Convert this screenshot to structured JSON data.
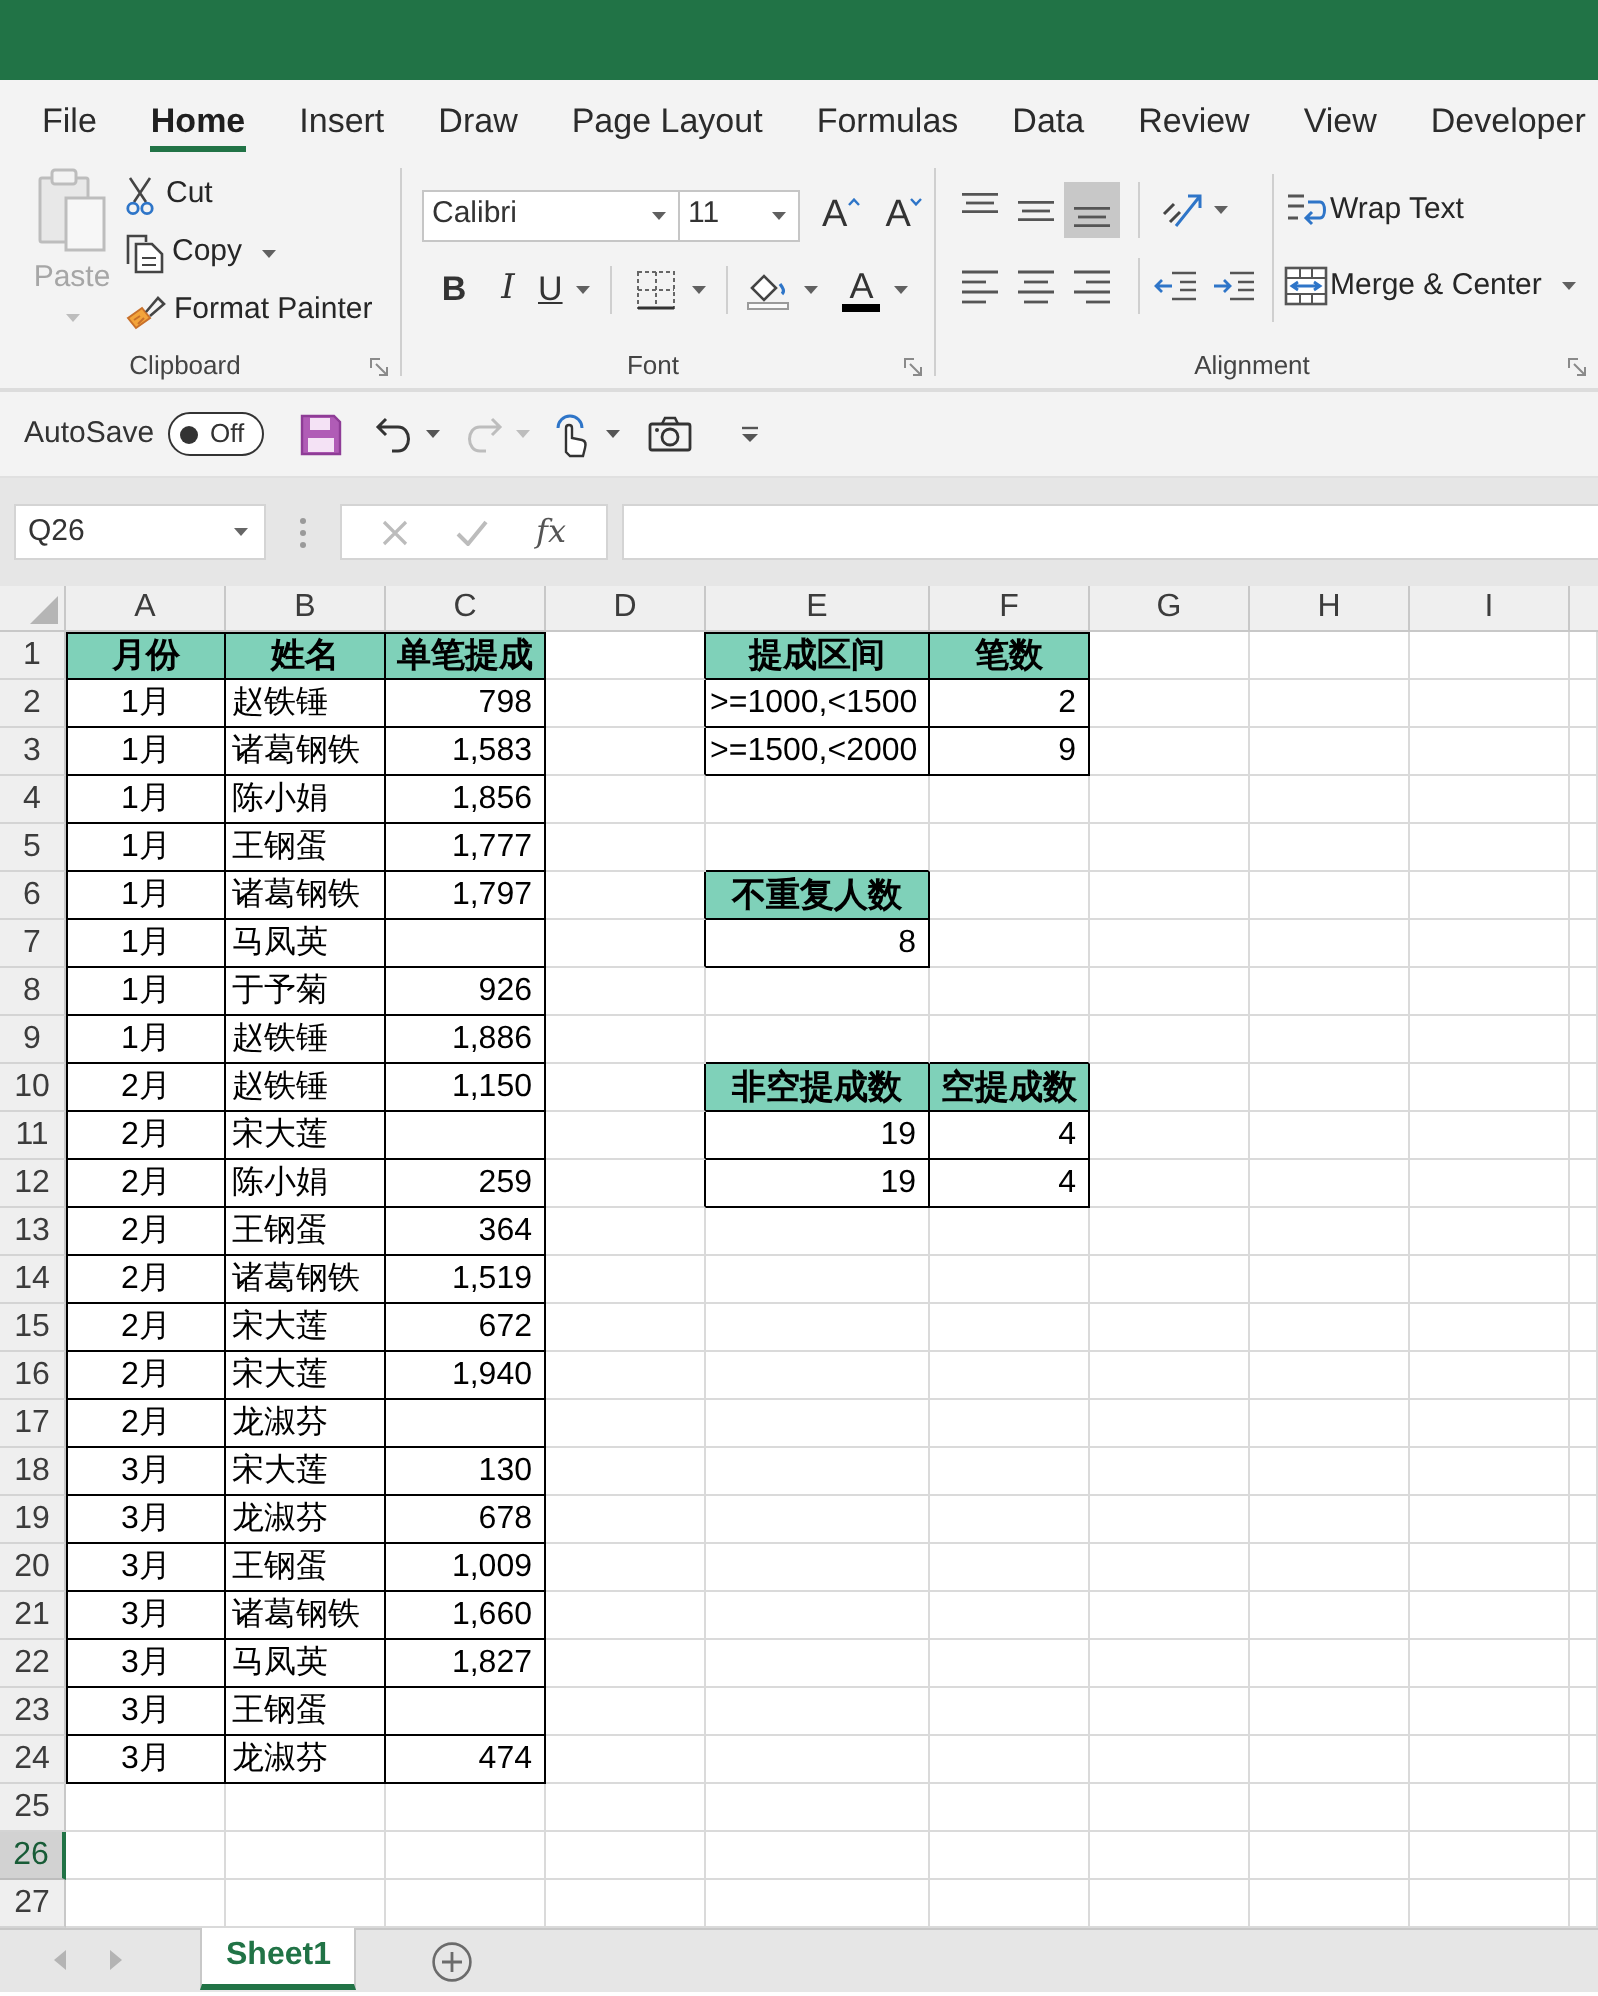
{
  "ribbon_tabs": [
    {
      "label": "File",
      "selected": false
    },
    {
      "label": "Home",
      "selected": true
    },
    {
      "label": "Insert",
      "selected": false
    },
    {
      "label": "Draw",
      "selected": false
    },
    {
      "label": "Page Layout",
      "selected": false
    },
    {
      "label": "Formulas",
      "selected": false
    },
    {
      "label": "Data",
      "selected": false
    },
    {
      "label": "Review",
      "selected": false
    },
    {
      "label": "View",
      "selected": false
    },
    {
      "label": "Developer",
      "selected": false
    }
  ],
  "clipboard": {
    "title": "Clipboard",
    "paste": {
      "label": "Paste",
      "disabled": true
    },
    "cut": "Cut",
    "copy": "Copy",
    "format_painter": "Format Painter"
  },
  "font": {
    "title": "Font",
    "name": "Calibri",
    "size": "11",
    "grow": "A",
    "shrink": "A",
    "bold": "B",
    "italic": "I",
    "underline": "U",
    "font_color": "A"
  },
  "alignment": {
    "title": "Alignment",
    "buttons": [
      {
        "kind": "top",
        "selected": false
      },
      {
        "kind": "middle",
        "selected": false
      },
      {
        "kind": "bottom",
        "selected": true
      },
      {
        "kind": "left",
        "selected": false
      },
      {
        "kind": "center",
        "selected": false
      },
      {
        "kind": "right",
        "selected": false
      }
    ],
    "wrap_text": "Wrap Text",
    "merge_center": "Merge & Center"
  },
  "quick_access": {
    "autosave_label": "AutoSave",
    "autosave": {
      "on": false,
      "label": "Off"
    },
    "redo": {
      "disabled": true
    }
  },
  "formula_bar": {
    "name_box": "Q26",
    "cancel": {
      "disabled": true
    },
    "enter": {
      "disabled": true
    },
    "function_label": "fx"
  },
  "sheet": {
    "columns": [
      "A",
      "B",
      "C",
      "D",
      "E",
      "F",
      "G",
      "H",
      "I"
    ],
    "rows": [
      {
        "label": "1",
        "selected": false
      },
      {
        "label": "2",
        "selected": false
      },
      {
        "label": "3",
        "selected": false
      },
      {
        "label": "4",
        "selected": false
      },
      {
        "label": "5",
        "selected": false
      },
      {
        "label": "6",
        "selected": false
      },
      {
        "label": "7",
        "selected": false
      },
      {
        "label": "8",
        "selected": false
      },
      {
        "label": "9",
        "selected": false
      },
      {
        "label": "10",
        "selected": false
      },
      {
        "label": "11",
        "selected": false
      },
      {
        "label": "12",
        "selected": false
      },
      {
        "label": "13",
        "selected": false
      },
      {
        "label": "14",
        "selected": false
      },
      {
        "label": "15",
        "selected": false
      },
      {
        "label": "16",
        "selected": false
      },
      {
        "label": "17",
        "selected": false
      },
      {
        "label": "18",
        "selected": false
      },
      {
        "label": "19",
        "selected": false
      },
      {
        "label": "20",
        "selected": false
      },
      {
        "label": "21",
        "selected": false
      },
      {
        "label": "22",
        "selected": false
      },
      {
        "label": "23",
        "selected": false
      },
      {
        "label": "24",
        "selected": false
      },
      {
        "label": "25",
        "selected": false
      },
      {
        "label": "26",
        "selected": true
      },
      {
        "label": "27",
        "selected": false
      }
    ]
  },
  "tables": [
    {
      "header": [
        "月份",
        "姓名",
        "单笔提成"
      ],
      "rows": [
        [
          "1月",
          "赵铁锤",
          "798"
        ],
        [
          "1月",
          "诸葛钢铁",
          "1,583"
        ],
        [
          "1月",
          "陈小娟",
          "1,856"
        ],
        [
          "1月",
          "王钢蛋",
          "1,777"
        ],
        [
          "1月",
          "诸葛钢铁",
          "1,797"
        ],
        [
          "1月",
          "马凤英"
        ],
        [
          "1月",
          "于予菊",
          "926"
        ],
        [
          "1月",
          "赵铁锤",
          "1,886"
        ],
        [
          "2月",
          "赵铁锤",
          "1,150"
        ],
        [
          "2月",
          "宋大莲"
        ],
        [
          "2月",
          "陈小娟",
          "259"
        ],
        [
          "2月",
          "王钢蛋",
          "364"
        ],
        [
          "2月",
          "诸葛钢铁",
          "1,519"
        ],
        [
          "2月",
          "宋大莲",
          "672"
        ],
        [
          "2月",
          "宋大莲",
          "1,940"
        ],
        [
          "2月",
          "龙淑芬"
        ],
        [
          "3月",
          "宋大莲",
          "130"
        ],
        [
          "3月",
          "龙淑芬",
          "678"
        ],
        [
          "3月",
          "王钢蛋",
          "1,009"
        ],
        [
          "3月",
          "诸葛钢铁",
          "1,660"
        ],
        [
          "3月",
          "马凤英",
          "1,827"
        ],
        [
          "3月",
          "王钢蛋"
        ],
        [
          "3月",
          "龙淑芬",
          "474"
        ]
      ]
    },
    {
      "header": [
        "提成区间",
        "笔数"
      ],
      "rows": [
        [
          ">=1000,<1500",
          "2"
        ],
        [
          ">=1500,<2000",
          "9"
        ]
      ]
    },
    {
      "header": [
        "不重复人数"
      ],
      "rows": [
        [
          "8"
        ]
      ]
    },
    {
      "header": [
        "非空提成数",
        "空提成数"
      ],
      "rows": [
        [
          "19",
          "4"
        ],
        [
          "19",
          "4"
        ]
      ]
    }
  ],
  "sheet_navigation": {
    "disabled": true
  },
  "sheet_tabs": [
    {
      "label": "Sheet1",
      "selected": true
    }
  ]
}
